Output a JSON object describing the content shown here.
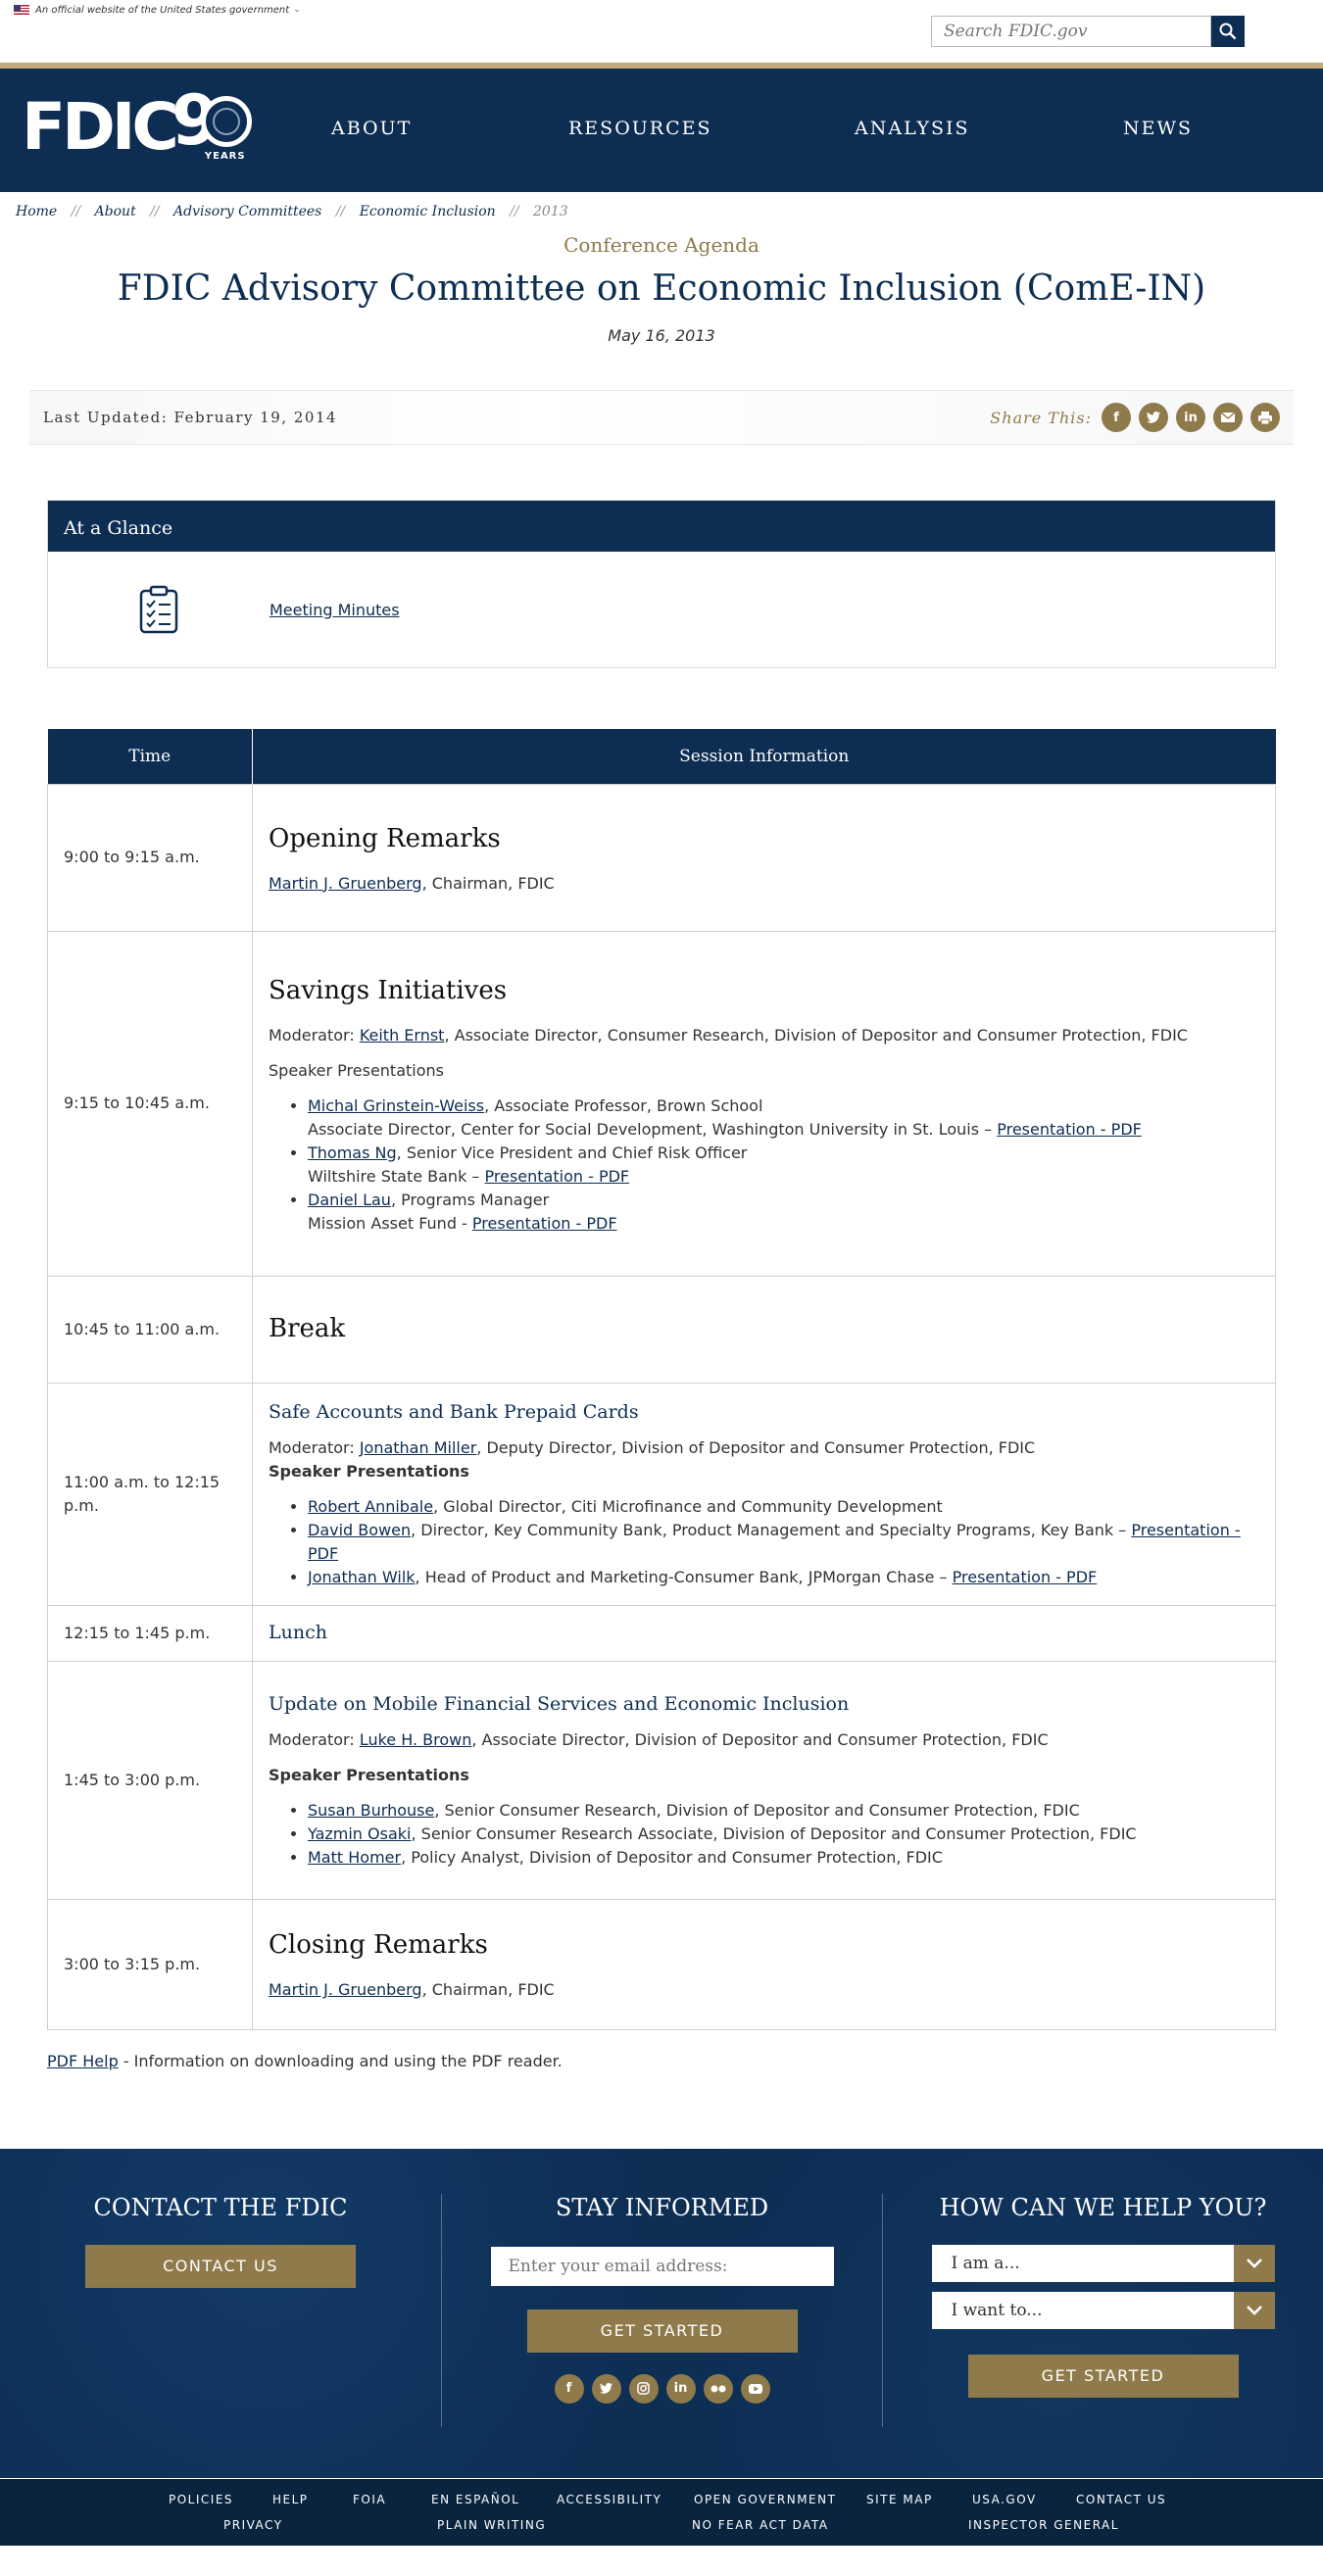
{
  "gov_banner": {
    "text": "An official website of the United States government"
  },
  "search": {
    "placeholder": "Search FDIC.gov"
  },
  "logo": {
    "text": "FDIC",
    "ninety": "9",
    "years": "YEARS"
  },
  "nav": {
    "items": [
      "ABOUT",
      "RESOURCES",
      "ANALYSIS",
      "NEWS"
    ]
  },
  "breadcrumb": {
    "items": [
      "Home",
      "About",
      "Advisory Committees",
      "Economic Inclusion"
    ],
    "current": "2013",
    "sep": "//"
  },
  "page": {
    "kicker": "Conference Agenda",
    "title": "FDIC Advisory Committee on Economic Inclusion (ComE-IN)",
    "date": "May 16, 2013",
    "last_updated": "Last Updated: February 19, 2014",
    "share_label": "Share This:"
  },
  "share_icons": [
    "facebook-icon",
    "twitter-icon",
    "linkedin-icon",
    "email-icon",
    "print-icon"
  ],
  "glance": {
    "title": "At a Glance",
    "link": "Meeting Minutes"
  },
  "agenda": {
    "headers": [
      "Time",
      "Session Information"
    ],
    "rows": [
      {
        "time": "9:00 to 9:15 a.m.",
        "title": "Opening Remarks",
        "person": "Martin J. Gruenberg",
        "role": ", Chairman, FDIC"
      },
      {
        "time": "9:15 to 10:45 a.m.",
        "title": "Savings Initiatives",
        "moderator_label": "Moderator: ",
        "moderator": "Keith Ernst",
        "moderator_role": ", Associate Director, Consumer Research, Division of Depositor and Consumer Protection, FDIC",
        "speaker_label": "Speaker Presentations",
        "speakers": [
          {
            "name": "Michal Grinstein-Weiss",
            "line1": ", Associate Professor, Brown School",
            "line2": "Associate Director, Center for Social Development, Washington University in St. Louis – ",
            "link": "Presentation - PDF"
          },
          {
            "name": "Thomas Ng",
            "line1": ", Senior Vice President and Chief Risk Officer",
            "line2": "Wiltshire State Bank – ",
            "link": "Presentation - PDF"
          },
          {
            "name": "Daniel Lau",
            "line1": ", Programs Manager",
            "line2": "Mission Asset Fund - ",
            "link": "Presentation - PDF"
          }
        ]
      },
      {
        "time": "10:45 to 11:00 a.m.",
        "title": "Break"
      },
      {
        "time": "11:00 a.m. to 12:15 p.m.",
        "title": "Safe Accounts and Bank Prepaid Cards",
        "moderator_label": "Moderator: ",
        "moderator": "Jonathan Miller",
        "moderator_role": ", Deputy Director, Division of Depositor and Consumer Protection, FDIC",
        "speaker_label": "Speaker Presentations",
        "speakers": [
          {
            "name": "Robert Annibale",
            "line1": ", Global Director, Citi Microfinance and Community Development",
            "link": ""
          },
          {
            "name": "David Bowen",
            "line1": ", Director, Key Community Bank, Product Management and Specialty Programs, Key Bank – ",
            "link": "Presentation - PDF"
          },
          {
            "name": "Jonathan Wilk",
            "line1": ", Head of Product and Marketing-Consumer Bank, JPMorgan Chase – ",
            "link": "Presentation - PDF"
          }
        ]
      },
      {
        "time": "12:15 to 1:45 p.m.",
        "title": "Lunch"
      },
      {
        "time": "1:45 to 3:00 p.m.",
        "title": "Update on Mobile Financial Services and Economic Inclusion",
        "moderator_label": "Moderator: ",
        "moderator": "Luke H. Brown",
        "moderator_role": ", Associate Director, Division of Depositor and Consumer Protection, FDIC",
        "speaker_label": "Speaker Presentations",
        "speakers": [
          {
            "name": "Susan Burhouse",
            "line1": ", Senior Consumer Research, Division of Depositor and Consumer Protection, FDIC"
          },
          {
            "name": "Yazmin Osaki",
            "line1": ", Senior Consumer Research Associate, Division of Depositor and Consumer Protection, FDIC"
          },
          {
            "name": "Matt Homer",
            "line1": ", Policy Analyst, Division of Depositor and Consumer Protection, FDIC"
          }
        ]
      },
      {
        "time": "3:00 to 3:15 p.m.",
        "title": "Closing Remarks",
        "person": "Martin J. Gruenberg",
        "role": ", Chairman, FDIC"
      }
    ]
  },
  "pdf_help": {
    "link": "PDF Help",
    "text": " - Information on downloading and using the PDF reader."
  },
  "footer": {
    "contact": {
      "title": "CONTACT THE FDIC",
      "button": "CONTACT US"
    },
    "stay": {
      "title": "STAY INFORMED",
      "placeholder": "Enter your email address:",
      "button": "GET STARTED"
    },
    "help": {
      "title": "HOW CAN WE HELP YOU?",
      "select1": "I am a...",
      "select2": "I want to...",
      "button": "GET STARTED"
    },
    "social_icons": [
      "facebook-icon",
      "twitter-icon",
      "instagram-icon",
      "linkedin-icon",
      "flickr-icon",
      "youtube-icon"
    ]
  },
  "footer_links": {
    "row1": [
      "POLICIES",
      "HELP",
      "FOIA",
      "EN ESPAÑOL",
      "ACCESSIBILITY",
      "OPEN GOVERNMENT",
      "SITE MAP",
      "USA.GOV",
      "CONTACT US"
    ],
    "row2": [
      "PRIVACY",
      "PLAIN WRITING",
      "NO FEAR ACT DATA",
      "INSPECTOR GENERAL"
    ]
  },
  "colors": {
    "navy": "#0d2d52",
    "gold": "#8e7a4a",
    "gold_rule": "#c2ab76"
  }
}
